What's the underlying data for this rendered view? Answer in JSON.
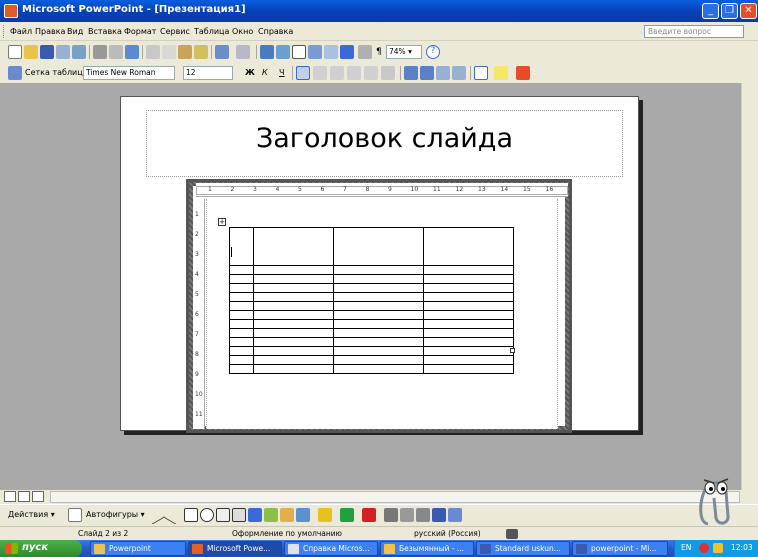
{
  "window": {
    "title": "Microsoft PowerPoint - [Презентация1]",
    "minimize_label": "_",
    "restore_label": "❐",
    "close_label": "✕"
  },
  "menu": {
    "items": [
      "Файл",
      "Правка",
      "Вид",
      "Вставка",
      "Формат",
      "Сервис",
      "Таблица",
      "Окно",
      "Справка"
    ],
    "help_placeholder": "Введите вопрос",
    "help_close": "▾ ×"
  },
  "standard_toolbar": {
    "zoom": "74%",
    "zoom_arrow": "▾",
    "pilcrow": "¶",
    "help_icon": "?"
  },
  "format_toolbar": {
    "table_grid_label": "Сетка таблицы",
    "font_name": "Times New Roman",
    "font_size": "12",
    "bold": "Ж",
    "italic": "К",
    "underline": "Ч"
  },
  "slide": {
    "title": "Заголовок слайда"
  },
  "ruler": {
    "h_marks": [
      "1",
      "2",
      "3",
      "4",
      "5",
      "6",
      "7",
      "8",
      "9",
      "10",
      "11",
      "12",
      "13",
      "14",
      "15",
      "16"
    ],
    "v_marks": [
      "1",
      "2",
      "3",
      "4",
      "5",
      "6",
      "7",
      "8",
      "9",
      "10",
      "11"
    ]
  },
  "table": {
    "rows": 13,
    "cols": 4
  },
  "drawing_toolbar": {
    "actions_label": "Действия ▾",
    "autoshapes_label": "Автофигуры ▾"
  },
  "status": {
    "slide_info": "Слайд 2 из 2",
    "design": "Оформление по умолчанию",
    "language": "русский (Россия)"
  },
  "taskbar": {
    "start_label": "пуск",
    "tasks": [
      {
        "label": "Powerpoint"
      },
      {
        "label": "Microsoft Powe..."
      },
      {
        "label": "Справка Micros..."
      },
      {
        "label": "Безымянный - ..."
      },
      {
        "label": "Standard uskun..."
      },
      {
        "label": "powerpoint - Mi..."
      }
    ],
    "tray_lang": "EN",
    "clock": "12:03"
  },
  "colors": {
    "title_bar": "#0842b8",
    "workspace": "#a9a9a9",
    "taskbar": "#2559c9",
    "start": "#2e8a2c"
  }
}
